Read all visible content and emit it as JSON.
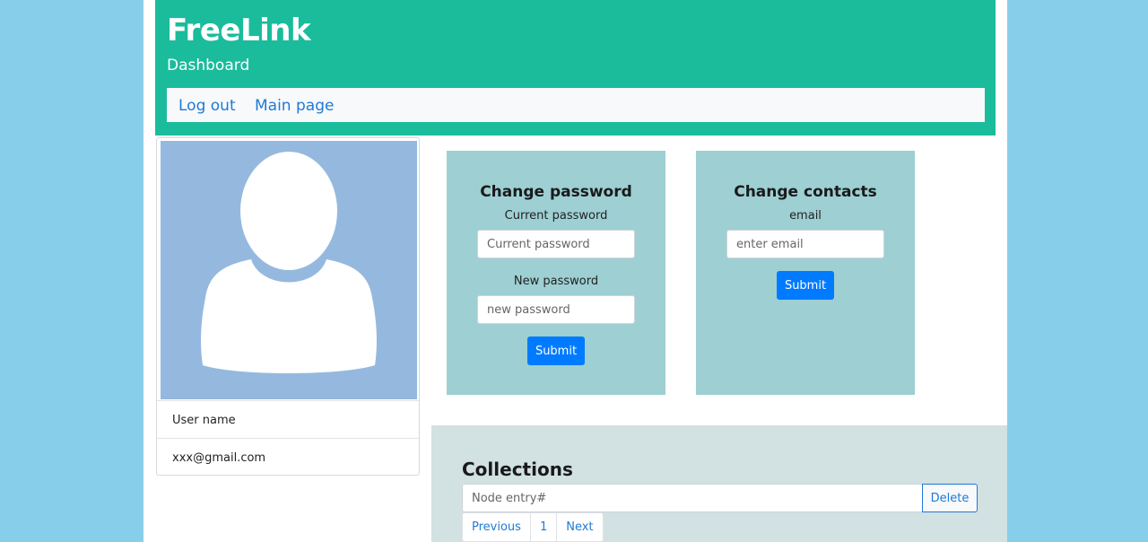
{
  "header": {
    "brand": "FreeLink",
    "subtitle": "Dashboard",
    "nav": [
      {
        "label": "Log out"
      },
      {
        "label": "Main page"
      }
    ]
  },
  "profile": {
    "avatar_icon": "user-silhouette-icon",
    "username": "User name",
    "email": "xxx@gmail.com"
  },
  "change_password": {
    "title": "Change password",
    "current_label": "Current password",
    "current_placeholder": "Current password",
    "new_label": "New password",
    "new_placeholder": "new password",
    "submit_label": "Submit"
  },
  "change_contacts": {
    "title": "Change contacts",
    "email_label": "email",
    "email_placeholder": "enter email",
    "submit_label": "Submit"
  },
  "collections": {
    "title": "Collections",
    "entry_placeholder": "Node entry#",
    "delete_label": "Delete",
    "pagination": {
      "previous": "Previous",
      "current_page": "1",
      "next": "Next"
    }
  },
  "colors": {
    "page_background": "#87ceeb",
    "header": "#1abc9c",
    "form_card": "#9dcfd3",
    "collections_panel": "#d2e1e2",
    "avatar_bg": "#95b9de",
    "primary": "#007bff",
    "link": "#1f7ad6"
  }
}
